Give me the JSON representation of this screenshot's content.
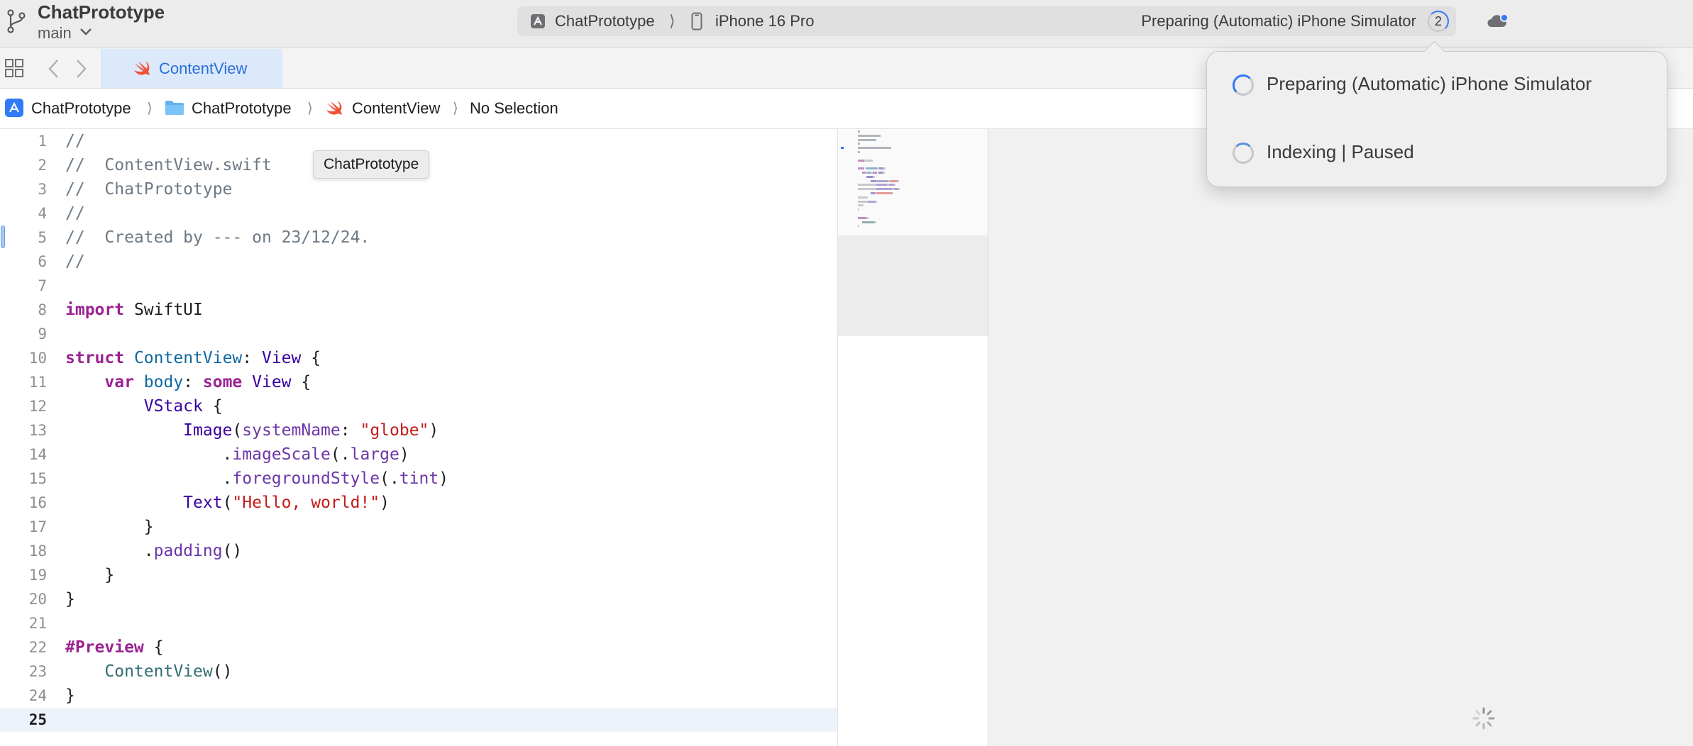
{
  "toolbar": {
    "project_title": "ChatPrototype",
    "branch": "main",
    "scheme": "ChatPrototype",
    "scheme_separator": "⟩",
    "device": "iPhone 16 Pro",
    "activity_status": "Preparing (Automatic) iPhone Simulator",
    "activity_count": "2"
  },
  "tabs": [
    {
      "label": "ContentView",
      "active": true
    }
  ],
  "breadcrumb": {
    "items": [
      "ChatPrototype",
      "ChatPrototype",
      "ContentView",
      "No Selection"
    ],
    "separator": "⟩"
  },
  "tooltip": "ChatPrototype",
  "editor": {
    "current_line": 25,
    "lines": [
      [
        [
          "comment",
          "//"
        ]
      ],
      [
        [
          "comment",
          "//  ContentView.swift"
        ]
      ],
      [
        [
          "comment",
          "//  ChatPrototype"
        ]
      ],
      [
        [
          "comment",
          "//"
        ]
      ],
      [
        [
          "comment",
          "//  Created by --- on 23/12/24."
        ]
      ],
      [
        [
          "comment",
          "//"
        ]
      ],
      [],
      [
        [
          "kw",
          "import"
        ],
        [
          "plain",
          " SwiftUI"
        ]
      ],
      [],
      [
        [
          "kw",
          "struct"
        ],
        [
          "plain",
          " "
        ],
        [
          "decl",
          "ContentView"
        ],
        [
          "plain",
          ": "
        ],
        [
          "type",
          "View"
        ],
        [
          "plain",
          " {"
        ]
      ],
      [
        [
          "plain",
          "    "
        ],
        [
          "kw",
          "var"
        ],
        [
          "plain",
          " "
        ],
        [
          "decl",
          "body"
        ],
        [
          "plain",
          ": "
        ],
        [
          "kw",
          "some"
        ],
        [
          "plain",
          " "
        ],
        [
          "type",
          "View"
        ],
        [
          "plain",
          " {"
        ]
      ],
      [
        [
          "plain",
          "        "
        ],
        [
          "type",
          "VStack"
        ],
        [
          "plain",
          " {"
        ]
      ],
      [
        [
          "plain",
          "            "
        ],
        [
          "type",
          "Image"
        ],
        [
          "plain",
          "("
        ],
        [
          "prop",
          "systemName"
        ],
        [
          "plain",
          ": "
        ],
        [
          "str",
          "\"globe\""
        ],
        [
          "plain",
          ")"
        ]
      ],
      [
        [
          "plain",
          "                ."
        ],
        [
          "prop",
          "imageScale"
        ],
        [
          "plain",
          "(."
        ],
        [
          "prop",
          "large"
        ],
        [
          "plain",
          ")"
        ]
      ],
      [
        [
          "plain",
          "                ."
        ],
        [
          "prop",
          "foregroundStyle"
        ],
        [
          "plain",
          "(."
        ],
        [
          "prop",
          "tint"
        ],
        [
          "plain",
          ")"
        ]
      ],
      [
        [
          "plain",
          "            "
        ],
        [
          "type",
          "Text"
        ],
        [
          "plain",
          "("
        ],
        [
          "str",
          "\"Hello, world!\""
        ],
        [
          "plain",
          ")"
        ]
      ],
      [
        [
          "plain",
          "        }"
        ]
      ],
      [
        [
          "plain",
          "        ."
        ],
        [
          "prop",
          "padding"
        ],
        [
          "plain",
          "()"
        ]
      ],
      [
        [
          "plain",
          "    }"
        ]
      ],
      [
        [
          "plain",
          "}"
        ]
      ],
      [],
      [
        [
          "kw",
          "#Preview"
        ],
        [
          "plain",
          " {"
        ]
      ],
      [
        [
          "plain",
          "    "
        ],
        [
          "ident",
          "ContentView"
        ],
        [
          "plain",
          "()"
        ]
      ],
      [
        [
          "plain",
          "}"
        ]
      ],
      []
    ]
  },
  "activity_popover": {
    "items": [
      {
        "label": "Preparing (Automatic) iPhone Simulator",
        "state": "active"
      },
      {
        "label": "Indexing | Paused",
        "state": "idle"
      }
    ]
  },
  "colors": {
    "accent": "#3478f6",
    "comment": "#6c7986",
    "keyword": "#9b2393",
    "type": "#3900a0",
    "string": "#c41a16",
    "swift": "#f05138"
  }
}
